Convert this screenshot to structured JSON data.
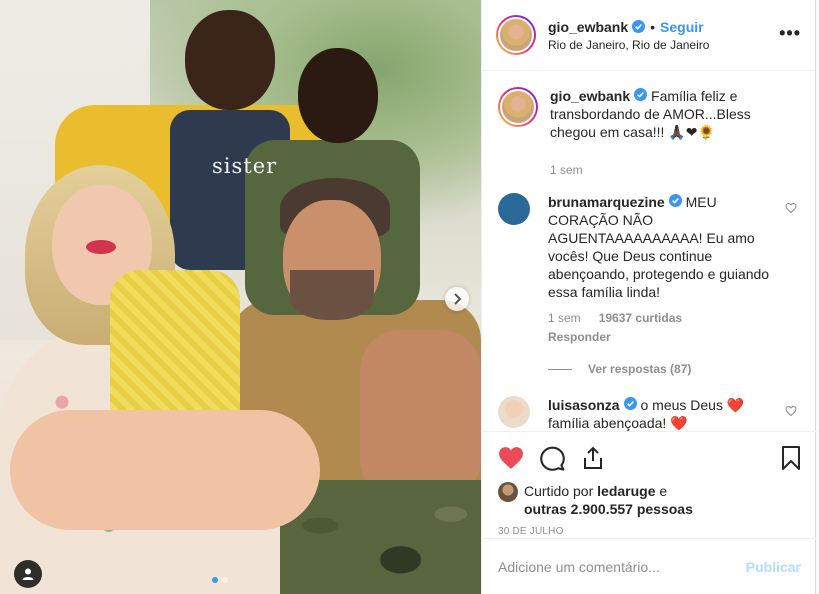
{
  "photo": {
    "shirt_text": "sister",
    "carousel_dots": 2,
    "active_dot": 0
  },
  "header": {
    "username": "gio_ewbank",
    "separator": "•",
    "follow_label": "Seguir",
    "location": "Rio de Janeiro, Rio de Janeiro",
    "more_label": "•••"
  },
  "caption": {
    "username": "gio_ewbank",
    "text": "Família feliz e transbordando de AMOR...Bless chegou em casa!!! 🙏🏿❤🌻",
    "time": "1 sem"
  },
  "comments": [
    {
      "username": "brunamarquezine",
      "text": "MEU CORAÇÃO NÃO AGUENTAAAAAAAAAA! Eu amo vocês! Que Deus continue abençoando, protegendo e guiando essa família linda!",
      "time": "1 sem",
      "likes": "19637 curtidas",
      "reply_label": "Responder",
      "view_replies": "Ver respostas (87)"
    },
    {
      "username": "luisasonza",
      "text": "o meus Deus ❤️ família abençoada! ❤️"
    }
  ],
  "likes": {
    "prefix": "Curtido por ",
    "user": "ledaruge",
    "middle": " e",
    "others": "outras 2.900.557 pessoas"
  },
  "date": "30 DE JULHO",
  "add_comment": {
    "placeholder": "Adicione um comentário...",
    "post_label": "Publicar"
  },
  "colors": {
    "accent": "#3897f0",
    "like_red": "#ed4956",
    "muted": "#8e8e8e",
    "post_disabled": "#b3dbff"
  }
}
